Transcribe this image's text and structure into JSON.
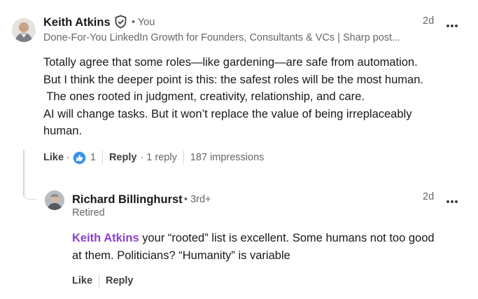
{
  "comment": {
    "author": "Keith Atkins",
    "verified_icon": "shield-check-icon",
    "degree": "• You",
    "headline": "Done-For-You LinkedIn Growth for Founders, Consultants & VCs | Sharp post...",
    "time": "2d",
    "more_icon": "ellipsis-icon",
    "lines": [
      "Totally agree that some roles—like gardening—are safe from automation.",
      "But I think the deeper point is this: the safest roles will be the most human.",
      " The ones rooted in judgment, creativity, relationship, and care.",
      "AI will change tasks. But it won’t replace the value of being irreplaceably",
      "human."
    ],
    "actions": {
      "like": "Like",
      "dot": "·",
      "reaction_icon": "thumbs-up-icon",
      "reaction_count": "1",
      "reply": "Reply",
      "reply_count": "· 1 reply",
      "impressions": "187 impressions"
    }
  },
  "reply": {
    "author": "Richard Billinghurst",
    "degree": "• 3rd+",
    "headline": "Retired",
    "time": "2d",
    "more_icon": "ellipsis-icon",
    "mention": "Keith Atkins",
    "line1_rest": " your “rooted” list is excellent. Some humans not too good",
    "line2": "at them. Politicians? “Humanity” is variable",
    "actions": {
      "like": "Like",
      "reply": "Reply"
    }
  },
  "colors": {
    "mention": "#8b3fd1",
    "like_blue": "#378fe9",
    "muted": "#666666"
  }
}
